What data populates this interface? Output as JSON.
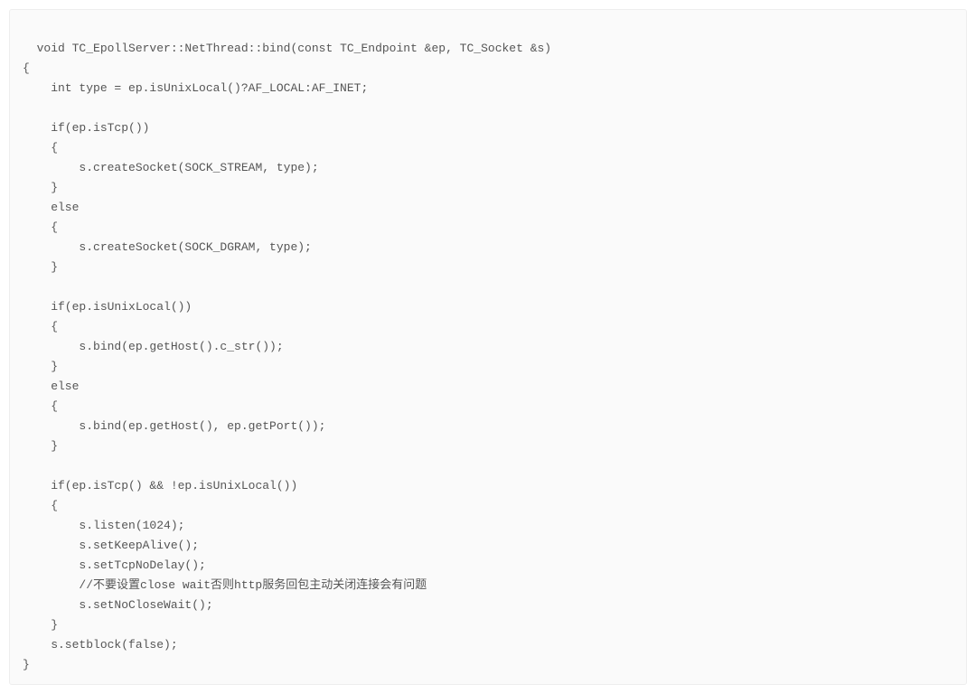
{
  "code": {
    "lines": [
      "void TC_EpollServer::NetThread::bind(const TC_Endpoint &ep, TC_Socket &s)",
      "{",
      "    int type = ep.isUnixLocal()?AF_LOCAL:AF_INET;",
      "",
      "    if(ep.isTcp())",
      "    {",
      "        s.createSocket(SOCK_STREAM, type);",
      "    }",
      "    else",
      "    {",
      "        s.createSocket(SOCK_DGRAM, type);",
      "    }",
      "",
      "    if(ep.isUnixLocal())",
      "    {",
      "        s.bind(ep.getHost().c_str());",
      "    }",
      "    else",
      "    {",
      "        s.bind(ep.getHost(), ep.getPort());",
      "    }",
      "",
      "    if(ep.isTcp() && !ep.isUnixLocal())",
      "    {",
      "        s.listen(1024);",
      "        s.setKeepAlive();",
      "        s.setTcpNoDelay();",
      "        //不要设置close wait否则http服务回包主动关闭连接会有问题",
      "        s.setNoCloseWait();",
      "    }",
      "    s.setblock(false);",
      "}"
    ]
  }
}
